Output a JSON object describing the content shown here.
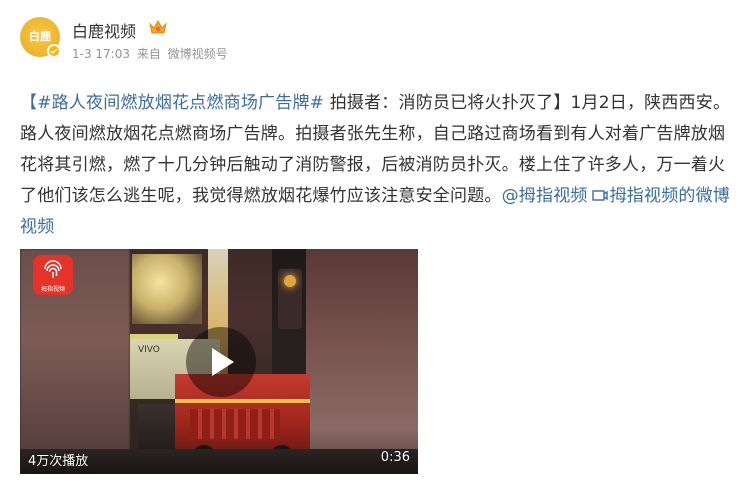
{
  "user": {
    "avatar_text": "白鹿",
    "name": "白鹿视频",
    "timestamp": "1-3 17:03",
    "source_prefix": "来自",
    "source": "微博视频号"
  },
  "post": {
    "bracket_open": "【",
    "topic": "#路人夜间燃放烟花点燃商场广告牌#",
    "headline": " 拍摄者：消防员已将火扑灭了",
    "bracket_close": "】",
    "body": "1月2日，陕西西安。路人夜间燃放烟花点燃商场广告牌。拍摄者张先生称，自己路过商场看到有人对着广告牌放烟花将其引燃，燃了十几分钟后触动了消防警报，后被消防员扑灭。楼上住了许多人，万一着火了他们该怎么逃生呢，我觉得燃放烟花爆竹应该注意安全问题。",
    "mention": "@拇指视频",
    "video_link": "拇指视频的微博视频"
  },
  "video": {
    "app_logo_text": "拇指视频",
    "facade_text": "VIVO",
    "play_count": "4万次播放",
    "duration": "0:36"
  },
  "colors": {
    "link": "#3a6da5",
    "text": "#333333",
    "meta": "#939393",
    "verified": "#ffb300",
    "app_logo": "#e6332a"
  }
}
